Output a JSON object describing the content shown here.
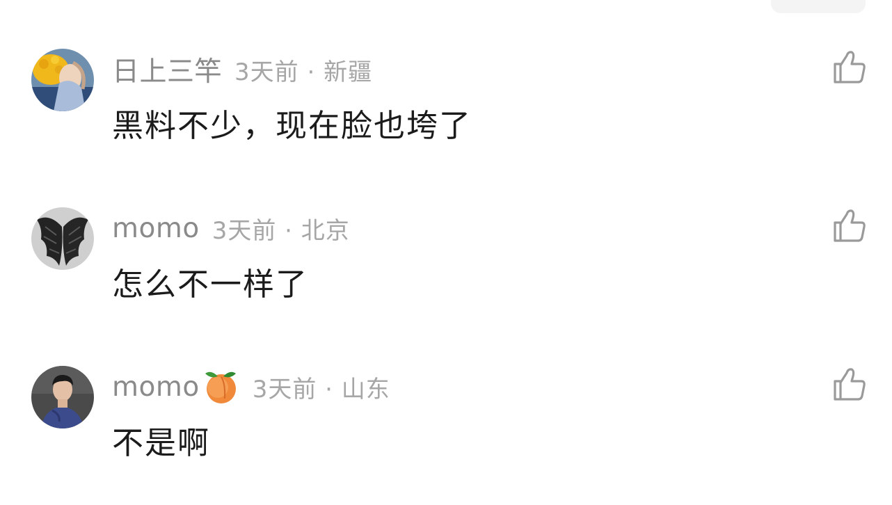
{
  "comments": [
    {
      "username": "日上三竿",
      "time_location": "3天前 · 新疆",
      "text": "黑料不少，现在脸也垮了",
      "avatar_icon": "avatar-flower-portrait",
      "badge": ""
    },
    {
      "username": "momo",
      "time_location": "3天前 · 北京",
      "text": "怎么不一样了",
      "avatar_icon": "avatar-dark-wings",
      "badge": ""
    },
    {
      "username": "momo",
      "time_location": "3天前 · 山东",
      "text": "不是啊",
      "avatar_icon": "avatar-man-portrait",
      "badge": "peach-emoji"
    }
  ],
  "colors": {
    "username": "#8a8a8a",
    "meta": "#a6a6a6",
    "text": "#1b1b1b",
    "icon": "#9a9a9a",
    "background": "#ffffff"
  }
}
